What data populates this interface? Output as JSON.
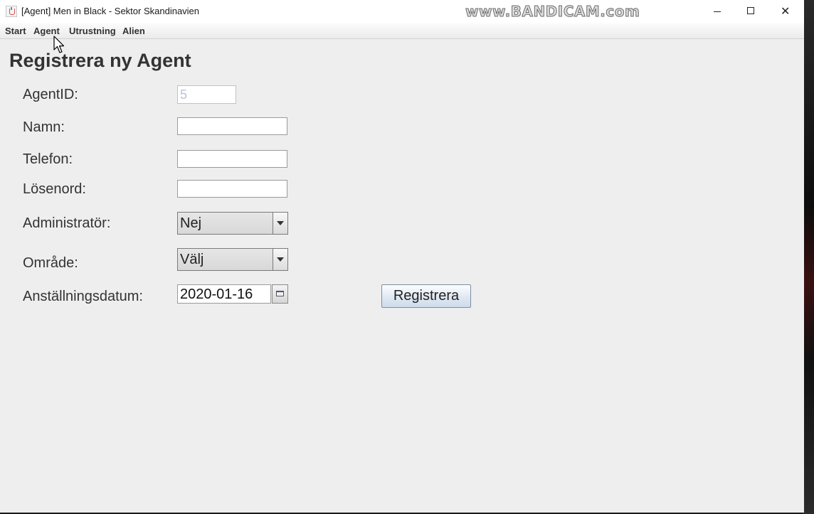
{
  "window": {
    "title": "[Agent] Men in Black - Sektor Skandinavien",
    "watermark": "www.BANDICAM.com"
  },
  "menu": {
    "items": [
      {
        "label": "Start"
      },
      {
        "label": "Agent"
      },
      {
        "label": "Utrustning"
      },
      {
        "label": "Alien"
      }
    ]
  },
  "form": {
    "heading": "Registrera ny Agent",
    "agentid": {
      "label": "AgentID:",
      "value": "5"
    },
    "namn": {
      "label": "Namn:",
      "value": ""
    },
    "telefon": {
      "label": "Telefon:",
      "value": ""
    },
    "losenord": {
      "label": "Lösenord:",
      "value": ""
    },
    "administrator": {
      "label": "Administratör:",
      "selected": "Nej"
    },
    "omrade": {
      "label": "Område:",
      "selected": "Välj"
    },
    "anstallningsdatum": {
      "label": "Anställningsdatum:",
      "value": "2020-01-16"
    },
    "submit_label": "Registrera"
  }
}
